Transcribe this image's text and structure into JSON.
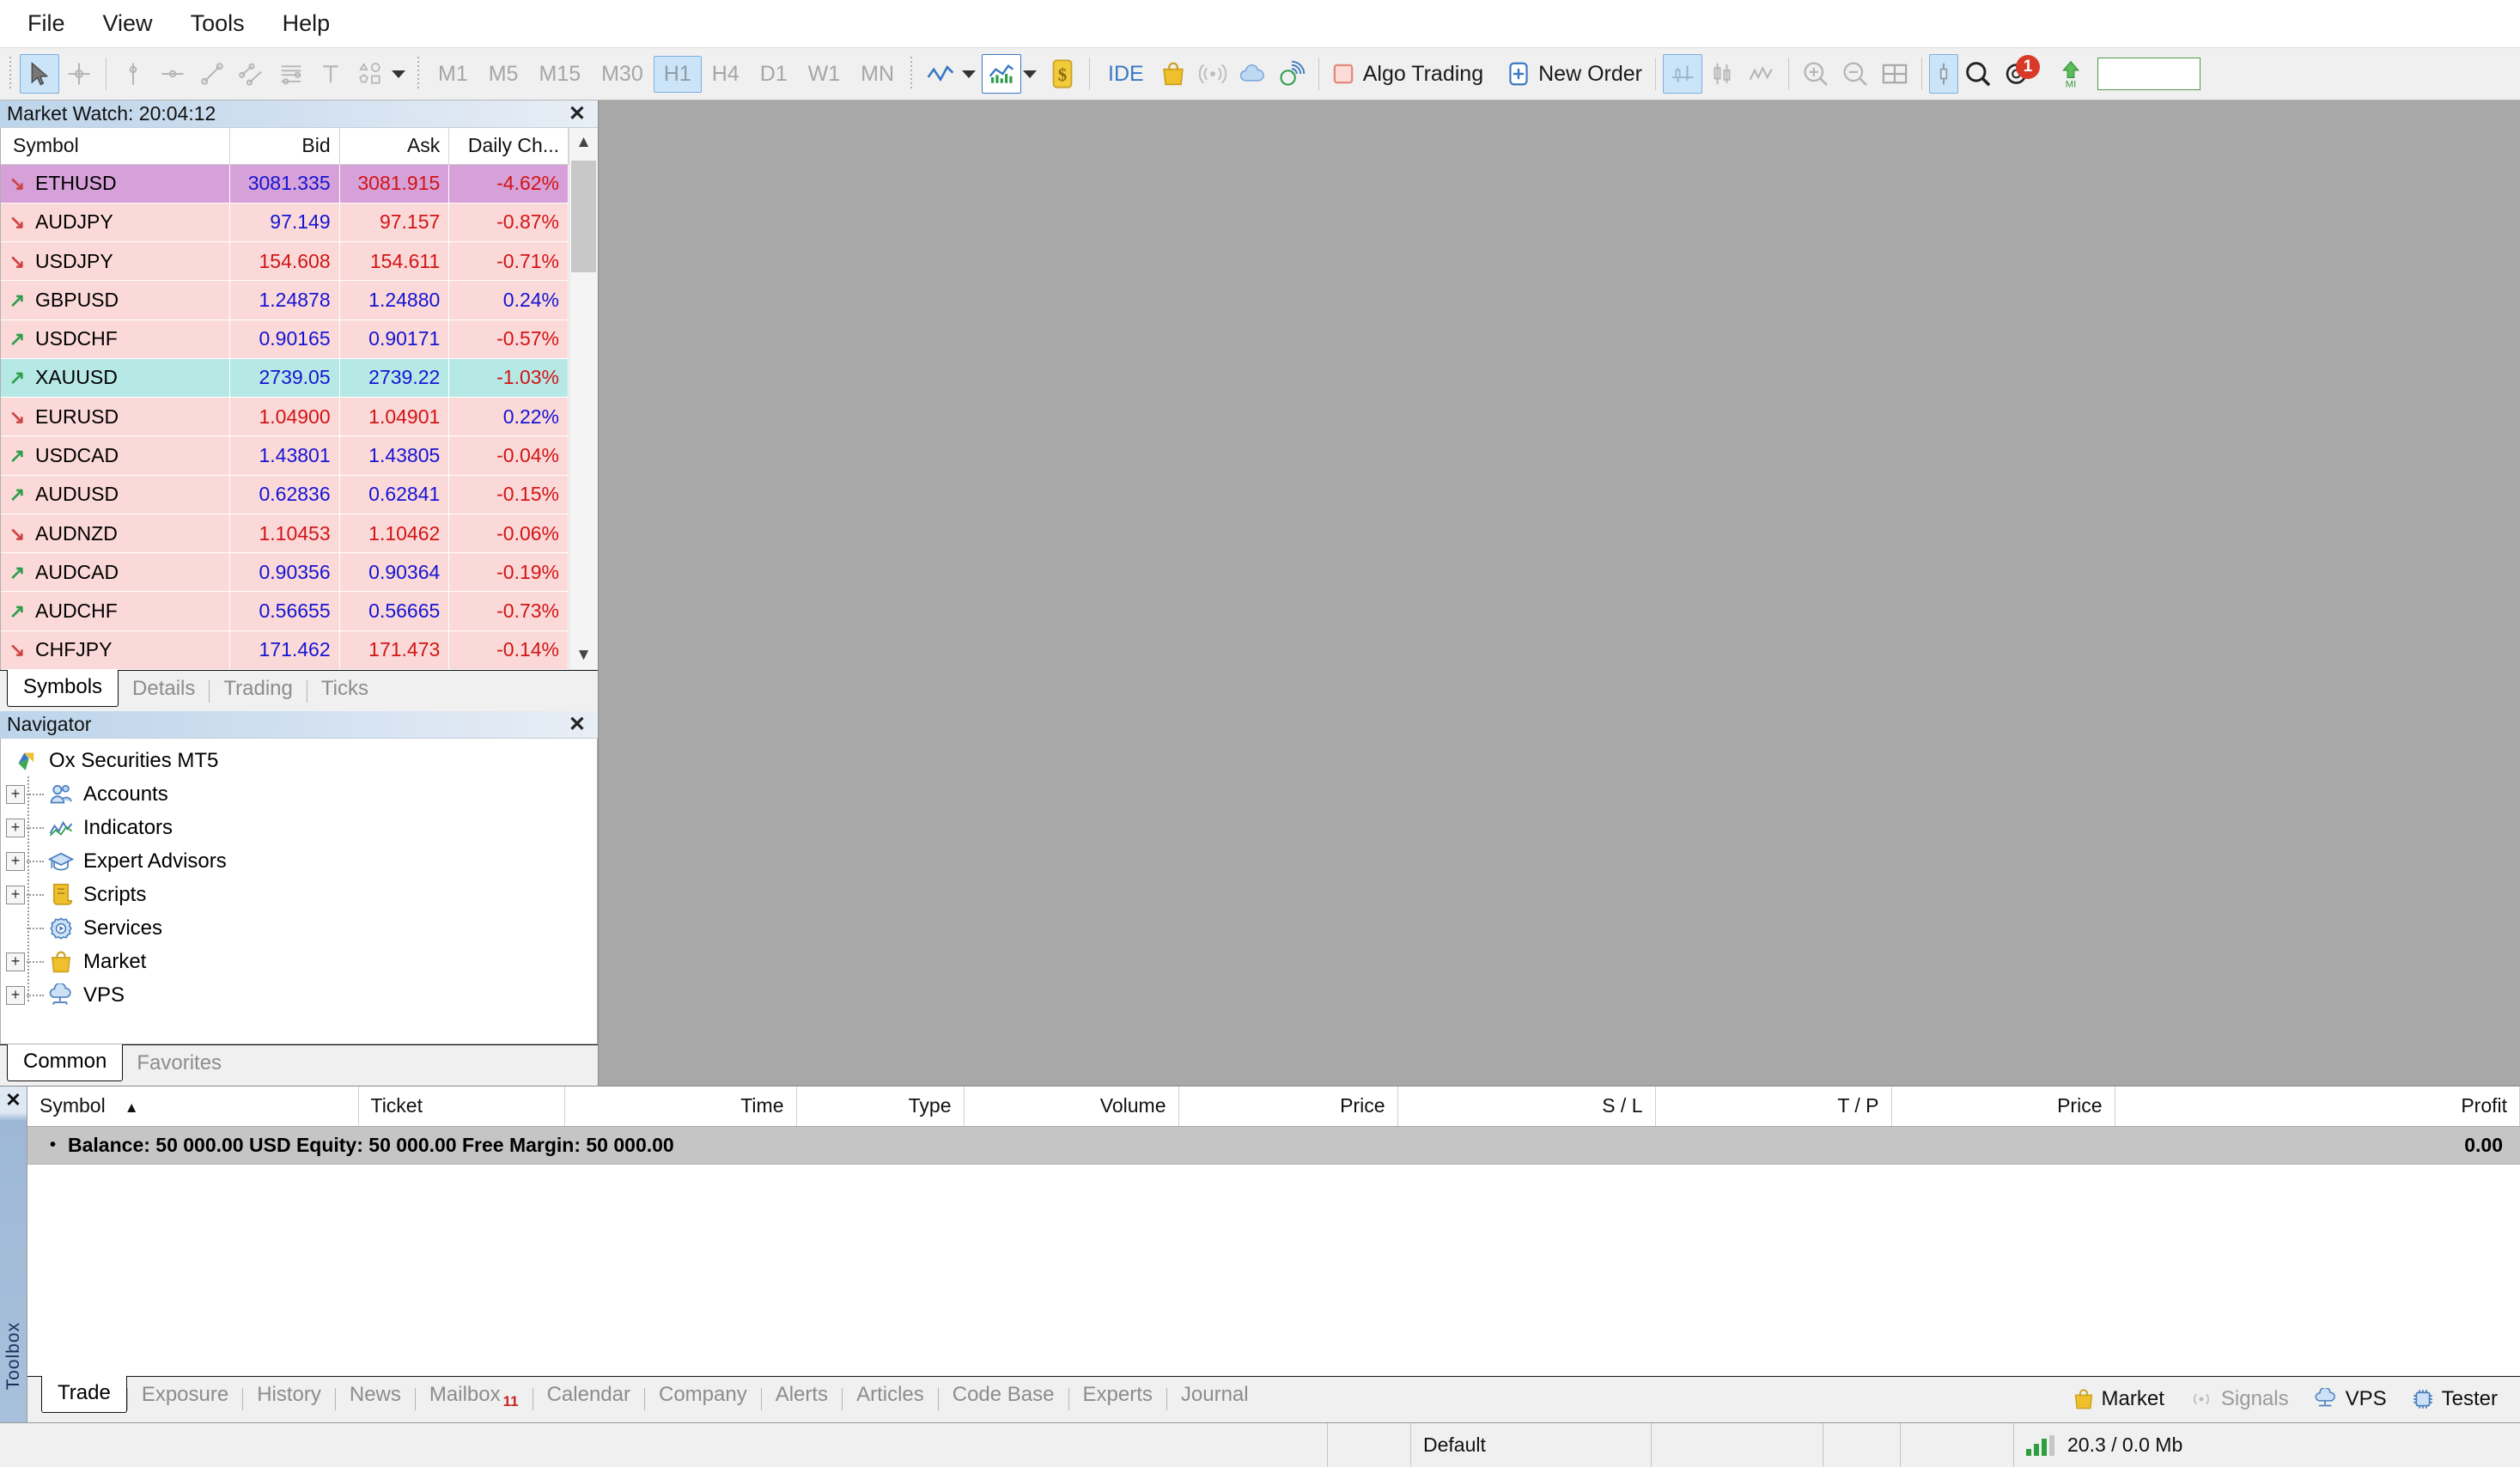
{
  "menu": {
    "items": [
      {
        "label": "File",
        "name": "menu-file"
      },
      {
        "label": "View",
        "name": "menu-view"
      },
      {
        "label": "Tools",
        "name": "menu-tools"
      },
      {
        "label": "Help",
        "name": "menu-help"
      }
    ]
  },
  "toolbar": {
    "timeframes": [
      {
        "label": "M1",
        "selected": false
      },
      {
        "label": "M5",
        "selected": false
      },
      {
        "label": "M15",
        "selected": false
      },
      {
        "label": "M30",
        "selected": false
      },
      {
        "label": "H1",
        "selected": true
      },
      {
        "label": "H4",
        "selected": false
      },
      {
        "label": "D1",
        "selected": false
      },
      {
        "label": "W1",
        "selected": false
      },
      {
        "label": "MN",
        "selected": false
      }
    ],
    "ide_label": "IDE",
    "algo_trading_label": "Algo Trading",
    "new_order_label": "New Order",
    "notification_badge": "1",
    "icons": [
      "cursor-icon",
      "crosshair-icon",
      "vertical-line-icon",
      "horizontal-line-icon",
      "trendline-icon",
      "channel-icon",
      "fibonacci-icon",
      "text-icon",
      "shapes-icon",
      "line-chart-icon",
      "bar-chart-icon",
      "dollar-icon",
      "ide-icon",
      "market-bag-icon",
      "signals-icon",
      "cloud-icon",
      "fingerprint-icon",
      "algo-trading-icon",
      "new-order-icon",
      "chart-shift-icon",
      "candles-icon",
      "indicators-icon",
      "zoom-in-icon",
      "zoom-out-icon",
      "tile-windows-icon",
      "data-window-icon",
      "search-icon",
      "notifications-icon",
      "mql5-icon"
    ],
    "search_value": ""
  },
  "market_watch": {
    "title": "Market Watch: 20:04:12",
    "columns": [
      "Symbol",
      "Bid",
      "Ask",
      "Daily Ch..."
    ],
    "rows": [
      {
        "dir": "down",
        "symbol": "ETHUSD",
        "bid": "3081.335",
        "ask": "3081.915",
        "change": "-4.62%",
        "row_bg": "#d6a0d8",
        "bid_color": "blue",
        "ask_color": "red",
        "change_color": "red"
      },
      {
        "dir": "down",
        "symbol": "AUDJPY",
        "bid": "97.149",
        "ask": "97.157",
        "change": "-0.87%",
        "row_bg": "#fbd9d9",
        "bid_color": "blue",
        "ask_color": "red",
        "change_color": "red"
      },
      {
        "dir": "down",
        "symbol": "USDJPY",
        "bid": "154.608",
        "ask": "154.611",
        "change": "-0.71%",
        "row_bg": "#fbd9d9",
        "bid_color": "red",
        "ask_color": "red",
        "change_color": "red"
      },
      {
        "dir": "up",
        "symbol": "GBPUSD",
        "bid": "1.24878",
        "ask": "1.24880",
        "change": "0.24%",
        "row_bg": "#fbd9d9",
        "bid_color": "blue",
        "ask_color": "blue",
        "change_color": "blue"
      },
      {
        "dir": "up",
        "symbol": "USDCHF",
        "bid": "0.90165",
        "ask": "0.90171",
        "change": "-0.57%",
        "row_bg": "#fbd9d9",
        "bid_color": "blue",
        "ask_color": "blue",
        "change_color": "red"
      },
      {
        "dir": "up",
        "symbol": "XAUUSD",
        "bid": "2739.05",
        "ask": "2739.22",
        "change": "-1.03%",
        "row_bg": "#b6e8e6",
        "bid_color": "blue",
        "ask_color": "blue",
        "change_color": "red"
      },
      {
        "dir": "down",
        "symbol": "EURUSD",
        "bid": "1.04900",
        "ask": "1.04901",
        "change": "0.22%",
        "row_bg": "#fbd9d9",
        "bid_color": "red",
        "ask_color": "red",
        "change_color": "blue"
      },
      {
        "dir": "up",
        "symbol": "USDCAD",
        "bid": "1.43801",
        "ask": "1.43805",
        "change": "-0.04%",
        "row_bg": "#fbd9d9",
        "bid_color": "blue",
        "ask_color": "blue",
        "change_color": "red"
      },
      {
        "dir": "up",
        "symbol": "AUDUSD",
        "bid": "0.62836",
        "ask": "0.62841",
        "change": "-0.15%",
        "row_bg": "#fbd9d9",
        "bid_color": "blue",
        "ask_color": "blue",
        "change_color": "red"
      },
      {
        "dir": "down",
        "symbol": "AUDNZD",
        "bid": "1.10453",
        "ask": "1.10462",
        "change": "-0.06%",
        "row_bg": "#fbd9d9",
        "bid_color": "red",
        "ask_color": "red",
        "change_color": "red"
      },
      {
        "dir": "up",
        "symbol": "AUDCAD",
        "bid": "0.90356",
        "ask": "0.90364",
        "change": "-0.19%",
        "row_bg": "#fbd9d9",
        "bid_color": "blue",
        "ask_color": "blue",
        "change_color": "red"
      },
      {
        "dir": "up",
        "symbol": "AUDCHF",
        "bid": "0.56655",
        "ask": "0.56665",
        "change": "-0.73%",
        "row_bg": "#fbd9d9",
        "bid_color": "blue",
        "ask_color": "blue",
        "change_color": "red"
      },
      {
        "dir": "down",
        "symbol": "CHFJPY",
        "bid": "171.462",
        "ask": "171.473",
        "change": "-0.14%",
        "row_bg": "#fbd9d9",
        "bid_color": "blue",
        "ask_color": "red",
        "change_color": "red"
      }
    ],
    "tabs": [
      {
        "label": "Symbols",
        "active": true
      },
      {
        "label": "Details",
        "active": false
      },
      {
        "label": "Trading",
        "active": false
      },
      {
        "label": "Ticks",
        "active": false
      }
    ]
  },
  "navigator": {
    "title": "Navigator",
    "tree": [
      {
        "label": "Ox Securities MT5",
        "icon": "mt5-logo-icon",
        "expander": "none",
        "root": true
      },
      {
        "label": "Accounts",
        "icon": "accounts-icon",
        "expander": "+"
      },
      {
        "label": "Indicators",
        "icon": "indicators-icon",
        "expander": "+"
      },
      {
        "label": "Expert Advisors",
        "icon": "expert-advisors-icon",
        "expander": "+"
      },
      {
        "label": "Scripts",
        "icon": "scripts-icon",
        "expander": "+"
      },
      {
        "label": "Services",
        "icon": "services-icon",
        "expander": "none"
      },
      {
        "label": "Market",
        "icon": "market-bag-icon",
        "expander": "+"
      },
      {
        "label": "VPS",
        "icon": "vps-cloud-icon",
        "expander": "+"
      }
    ],
    "tabs": [
      {
        "label": "Common",
        "active": true
      },
      {
        "label": "Favorites",
        "active": false
      }
    ]
  },
  "toolbox": {
    "vertical_label": "Toolbox",
    "columns": [
      {
        "label": "Symbol",
        "align": "left",
        "sort": "▲"
      },
      {
        "label": "Ticket",
        "align": "left"
      },
      {
        "label": "Time",
        "align": "right"
      },
      {
        "label": "Type",
        "align": "right"
      },
      {
        "label": "Volume",
        "align": "right"
      },
      {
        "label": "Price",
        "align": "right"
      },
      {
        "label": "S / L",
        "align": "right"
      },
      {
        "label": "T / P",
        "align": "right"
      },
      {
        "label": "Price",
        "align": "right"
      },
      {
        "label": "Profit",
        "align": "right"
      }
    ],
    "summary": {
      "text": "Balance: 50 000.00 USD  Equity: 50 000.00  Free Margin: 50 000.00",
      "profit": "0.00"
    },
    "tabs": [
      {
        "label": "Trade",
        "active": true
      },
      {
        "label": "Exposure",
        "active": false
      },
      {
        "label": "History",
        "active": false
      },
      {
        "label": "News",
        "active": false
      },
      {
        "label": "Mailbox",
        "active": false,
        "badge": "11"
      },
      {
        "label": "Calendar",
        "active": false
      },
      {
        "label": "Company",
        "active": false
      },
      {
        "label": "Alerts",
        "active": false
      },
      {
        "label": "Articles",
        "active": false
      },
      {
        "label": "Code Base",
        "active": false
      },
      {
        "label": "Experts",
        "active": false
      },
      {
        "label": "Journal",
        "active": false
      }
    ],
    "status_links": [
      {
        "label": "Market",
        "icon": "market-bag-icon",
        "dim": false
      },
      {
        "label": "Signals",
        "icon": "signals-icon",
        "dim": true
      },
      {
        "label": "VPS",
        "icon": "vps-cloud-icon",
        "dim": false
      },
      {
        "label": "Tester",
        "icon": "tester-chip-icon",
        "dim": false
      }
    ]
  },
  "statusbar": {
    "profile": "Default",
    "traffic": "20.3 / 0.0 Mb"
  },
  "colors": {
    "accent_blue": "#1414d2",
    "negative_red": "#d21414",
    "highlight_purple": "#d6a0d8",
    "highlight_cyan": "#b6e8e6",
    "row_pink": "#fbd9d9",
    "badge_red": "#d93a28",
    "up_green": "#2e9e4a"
  }
}
